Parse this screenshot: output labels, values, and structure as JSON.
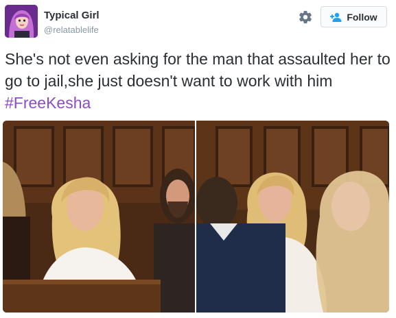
{
  "author": {
    "display_name": "Typical Girl",
    "handle": "@relatablelife",
    "avatar_icon": "avatar-image"
  },
  "actions": {
    "settings_icon": "gear-icon",
    "follow_label": "Follow",
    "follow_icon": "add-person-icon"
  },
  "tweet": {
    "text": "She's not even asking for the man that assaulted her to go to jail,she just doesn't want to work with him ",
    "hashtag": "#FreeKesha"
  },
  "media": [
    {
      "icon": "courtroom-photo-left"
    },
    {
      "icon": "courtroom-photo-right"
    }
  ],
  "colors": {
    "hashtag": "#8d4cc3",
    "text": "#292f33",
    "secondary": "#8899a6",
    "follow_icon": "#1da1f2"
  }
}
